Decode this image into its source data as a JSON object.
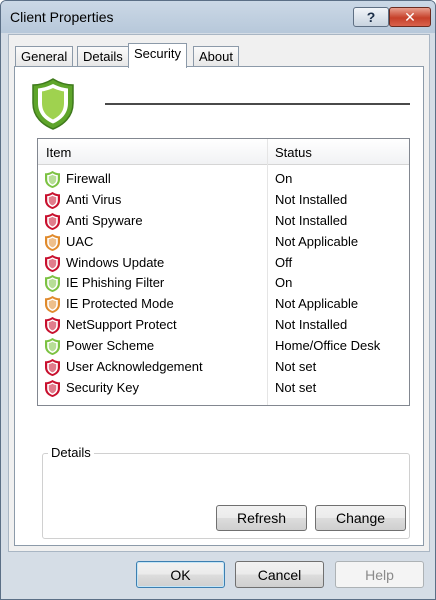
{
  "window": {
    "title": "Client Properties",
    "help_caption": "?",
    "close_caption": "✕"
  },
  "tabs": [
    {
      "label": "General",
      "active": false
    },
    {
      "label": "Details",
      "active": false
    },
    {
      "label": "Security",
      "active": true
    },
    {
      "label": "About",
      "active": false
    }
  ],
  "security": {
    "header_shield": "green-shield-icon",
    "list": {
      "col_item": "Item",
      "col_status": "Status",
      "rows": [
        {
          "item": "Firewall",
          "status": "On",
          "shield": "green"
        },
        {
          "item": "Anti Virus",
          "status": "Not Installed",
          "shield": "red"
        },
        {
          "item": "Anti Spyware",
          "status": "Not Installed",
          "shield": "red"
        },
        {
          "item": "UAC",
          "status": "Not Applicable",
          "shield": "orange"
        },
        {
          "item": "Windows Update",
          "status": "Off",
          "shield": "red"
        },
        {
          "item": "IE Phishing Filter",
          "status": "On",
          "shield": "green"
        },
        {
          "item": "IE Protected Mode",
          "status": "Not Applicable",
          "shield": "orange"
        },
        {
          "item": "NetSupport Protect",
          "status": "Not Installed",
          "shield": "red"
        },
        {
          "item": "Power Scheme",
          "status": "Home/Office Desk",
          "shield": "green"
        },
        {
          "item": "User Acknowledgement",
          "status": "Not set",
          "shield": "red"
        },
        {
          "item": "Security Key",
          "status": "Not set",
          "shield": "red"
        }
      ]
    },
    "details": {
      "label": "Details",
      "refresh_label": "Refresh",
      "change_label": "Change"
    }
  },
  "buttons": {
    "ok": "OK",
    "cancel": "Cancel",
    "help": "Help"
  },
  "colors": {
    "shield_green": "#7cc242",
    "shield_red": "#c8102e",
    "shield_orange": "#e08a2c",
    "close_red": "#c6402a"
  }
}
